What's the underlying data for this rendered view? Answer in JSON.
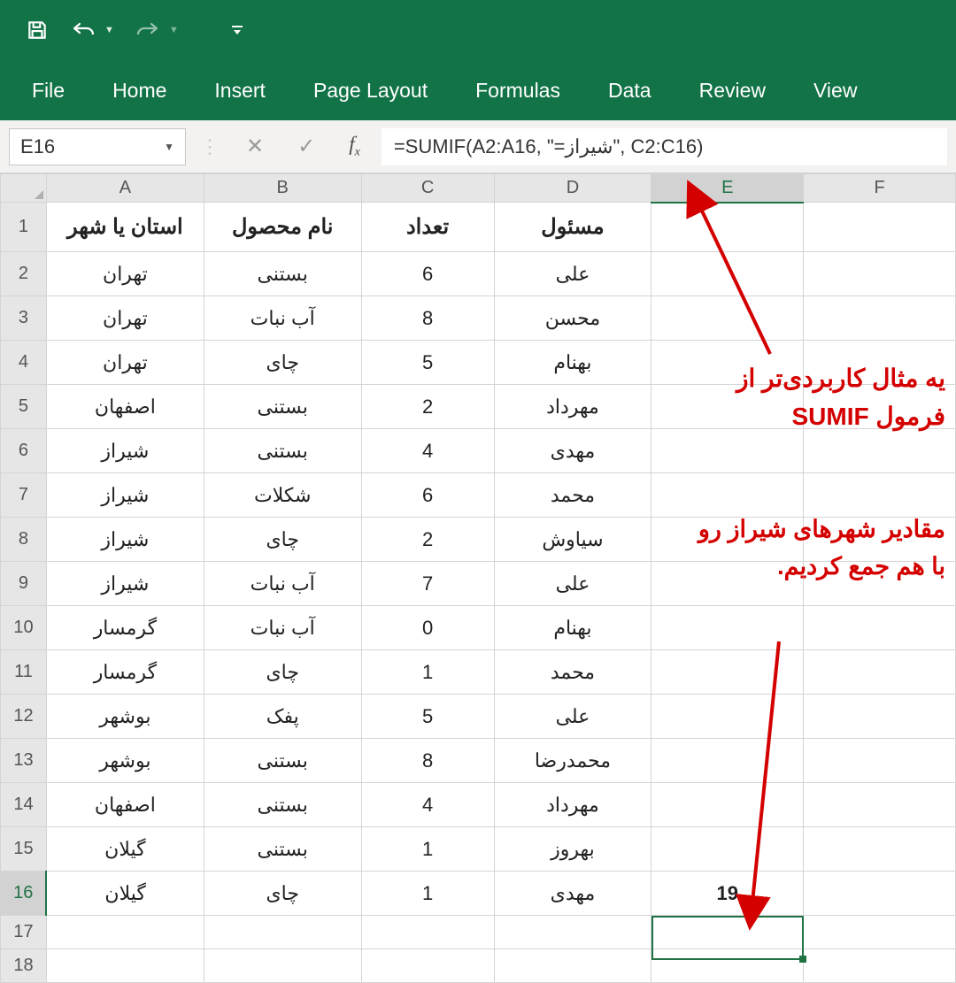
{
  "titlebar": {
    "save_icon": "save-icon",
    "undo_icon": "undo-icon",
    "redo_icon": "redo-icon",
    "customize_icon": "customize-qat-icon"
  },
  "ribbon": {
    "tabs": [
      "File",
      "Home",
      "Insert",
      "Page Layout",
      "Formulas",
      "Data",
      "Review",
      "View"
    ]
  },
  "formula_bar": {
    "name_box": "E16",
    "cancel_label": "✕",
    "enter_label": "✓",
    "fx_label": "fx",
    "formula": "=SUMIF(A2:A16, \"=شیراز\", C2:C16)"
  },
  "columns": [
    "A",
    "B",
    "C",
    "D",
    "E",
    "F"
  ],
  "header_row": {
    "A": "استان یا شهر",
    "B": "نام محصول",
    "C": "تعداد",
    "D": "مسئول"
  },
  "rows": [
    {
      "n": 2,
      "A": "تهران",
      "B": "بستنی",
      "C": "6",
      "D": "علی"
    },
    {
      "n": 3,
      "A": "تهران",
      "B": "آب نبات",
      "C": "8",
      "D": "محسن"
    },
    {
      "n": 4,
      "A": "تهران",
      "B": "چای",
      "C": "5",
      "D": "بهنام"
    },
    {
      "n": 5,
      "A": "اصفهان",
      "B": "بستنی",
      "C": "2",
      "D": "مهرداد"
    },
    {
      "n": 6,
      "A": "شیراز",
      "B": "بستنی",
      "C": "4",
      "D": "مهدی"
    },
    {
      "n": 7,
      "A": "شیراز",
      "B": "شکلات",
      "C": "6",
      "D": "محمد"
    },
    {
      "n": 8,
      "A": "شیراز",
      "B": "چای",
      "C": "2",
      "D": "سیاوش"
    },
    {
      "n": 9,
      "A": "شیراز",
      "B": "آب نبات",
      "C": "7",
      "D": "علی"
    },
    {
      "n": 10,
      "A": "گرمسار",
      "B": "آب نبات",
      "C": "0",
      "D": "بهنام"
    },
    {
      "n": 11,
      "A": "گرمسار",
      "B": "چای",
      "C": "1",
      "D": "محمد"
    },
    {
      "n": 12,
      "A": "بوشهر",
      "B": "پفک",
      "C": "5",
      "D": "علی"
    },
    {
      "n": 13,
      "A": "بوشهر",
      "B": "بستنی",
      "C": "8",
      "D": "محمدرضا"
    },
    {
      "n": 14,
      "A": "اصفهان",
      "B": "بستنی",
      "C": "4",
      "D": "مهرداد"
    },
    {
      "n": 15,
      "A": "گیلان",
      "B": "بستنی",
      "C": "1",
      "D": "بهروز"
    },
    {
      "n": 16,
      "A": "گیلان",
      "B": "چای",
      "C": "1",
      "D": "مهدی",
      "E": "19"
    }
  ],
  "empty_rows": [
    17,
    18
  ],
  "active_cell": "E16",
  "annotations": {
    "line1": "یه مثال کاربردی‌تر از فرمول SUMIF",
    "line2": "مقادیر شهرهای شیراز رو با هم جمع کردیم."
  }
}
